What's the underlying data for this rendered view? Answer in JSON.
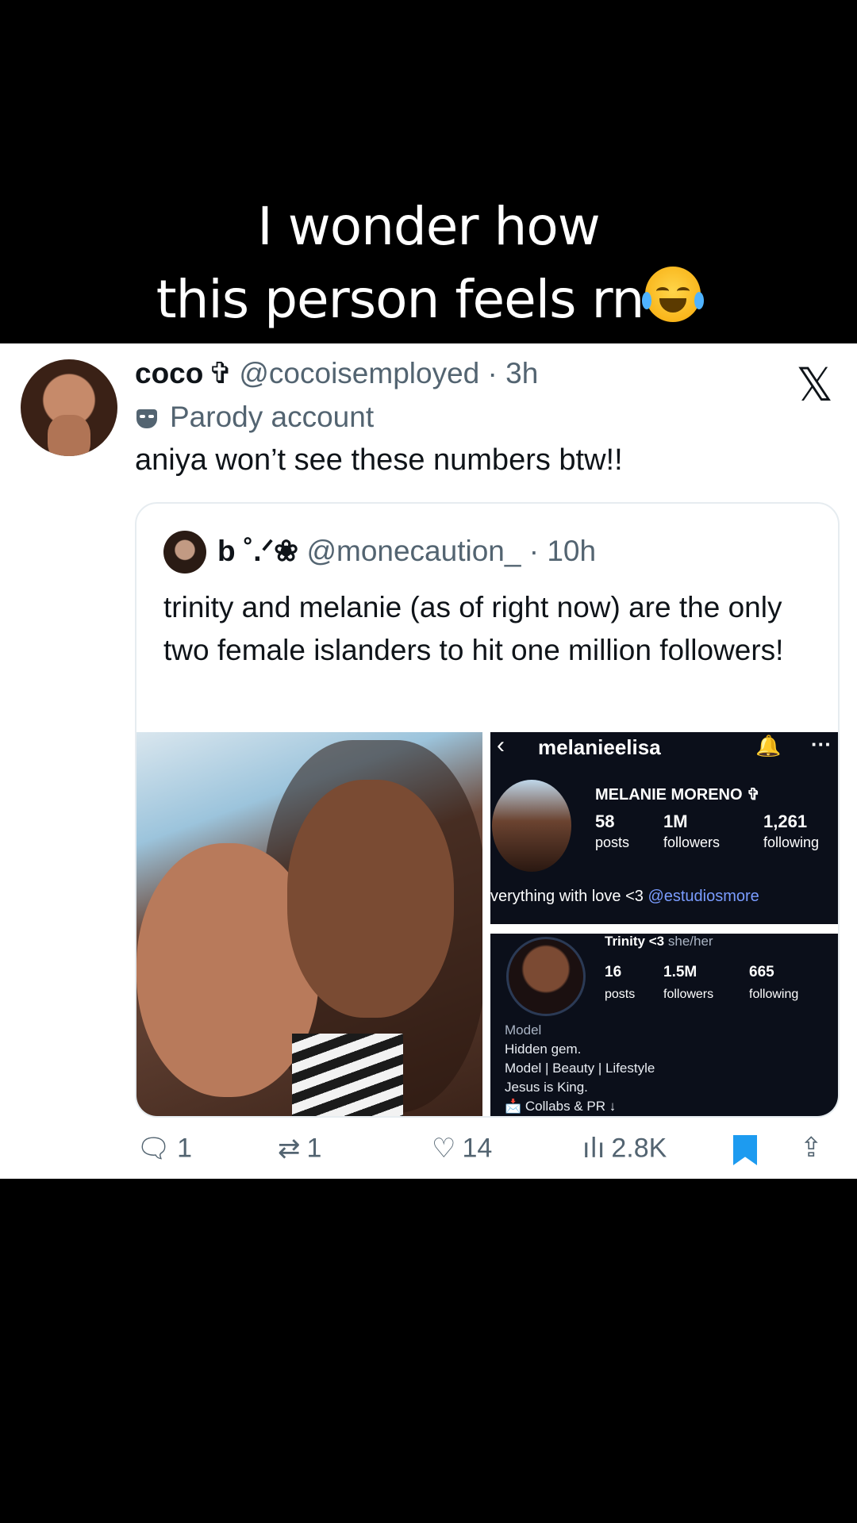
{
  "caption": {
    "line1": "I wonder how",
    "line2": "this person feels rn"
  },
  "tweet": {
    "name": "coco",
    "name_symbol": "✞",
    "handle": "@cocoisemployed",
    "time": "· 3h",
    "label": "Parody account",
    "text": "aniya won’t see these numbers btw!!",
    "platform_logo": "𝕏"
  },
  "quote": {
    "name": "b ˚.ᐟ❀",
    "handle": "@monecaution_",
    "time": "· 10h",
    "text": "trinity and melanie (as of right now) are the only two female islanders to hit one million followers!"
  },
  "ig_profile_1": {
    "username": "melanieelisa",
    "full_name": "MELANIE MORENO ✞",
    "posts": "58",
    "posts_label": "posts",
    "followers": "1M",
    "followers_label": "followers",
    "following": "1,261",
    "following_label": "following",
    "bio_text": "verything with love <3 ",
    "bio_tag": "@estudiosmore"
  },
  "ig_profile_2": {
    "display_name": "Trinity <3",
    "pronouns": "she/her",
    "posts": "16",
    "posts_label": "posts",
    "followers": "1.5M",
    "followers_label": "followers",
    "following": "665",
    "following_label": "following",
    "category": "Model",
    "bio_line1": "Hidden gem.",
    "bio_line2": "Model | Beauty | Lifestyle",
    "bio_line3": "Jesus is King.",
    "bio_line4": "📩 Collabs & PR ↓"
  },
  "actions": {
    "replies": "1",
    "reposts": "1",
    "likes": "14",
    "views": "2.8K"
  },
  "colors": {
    "accent": "#1d9bf0",
    "muted": "#536471",
    "ig_bg": "#0b0f1a"
  }
}
